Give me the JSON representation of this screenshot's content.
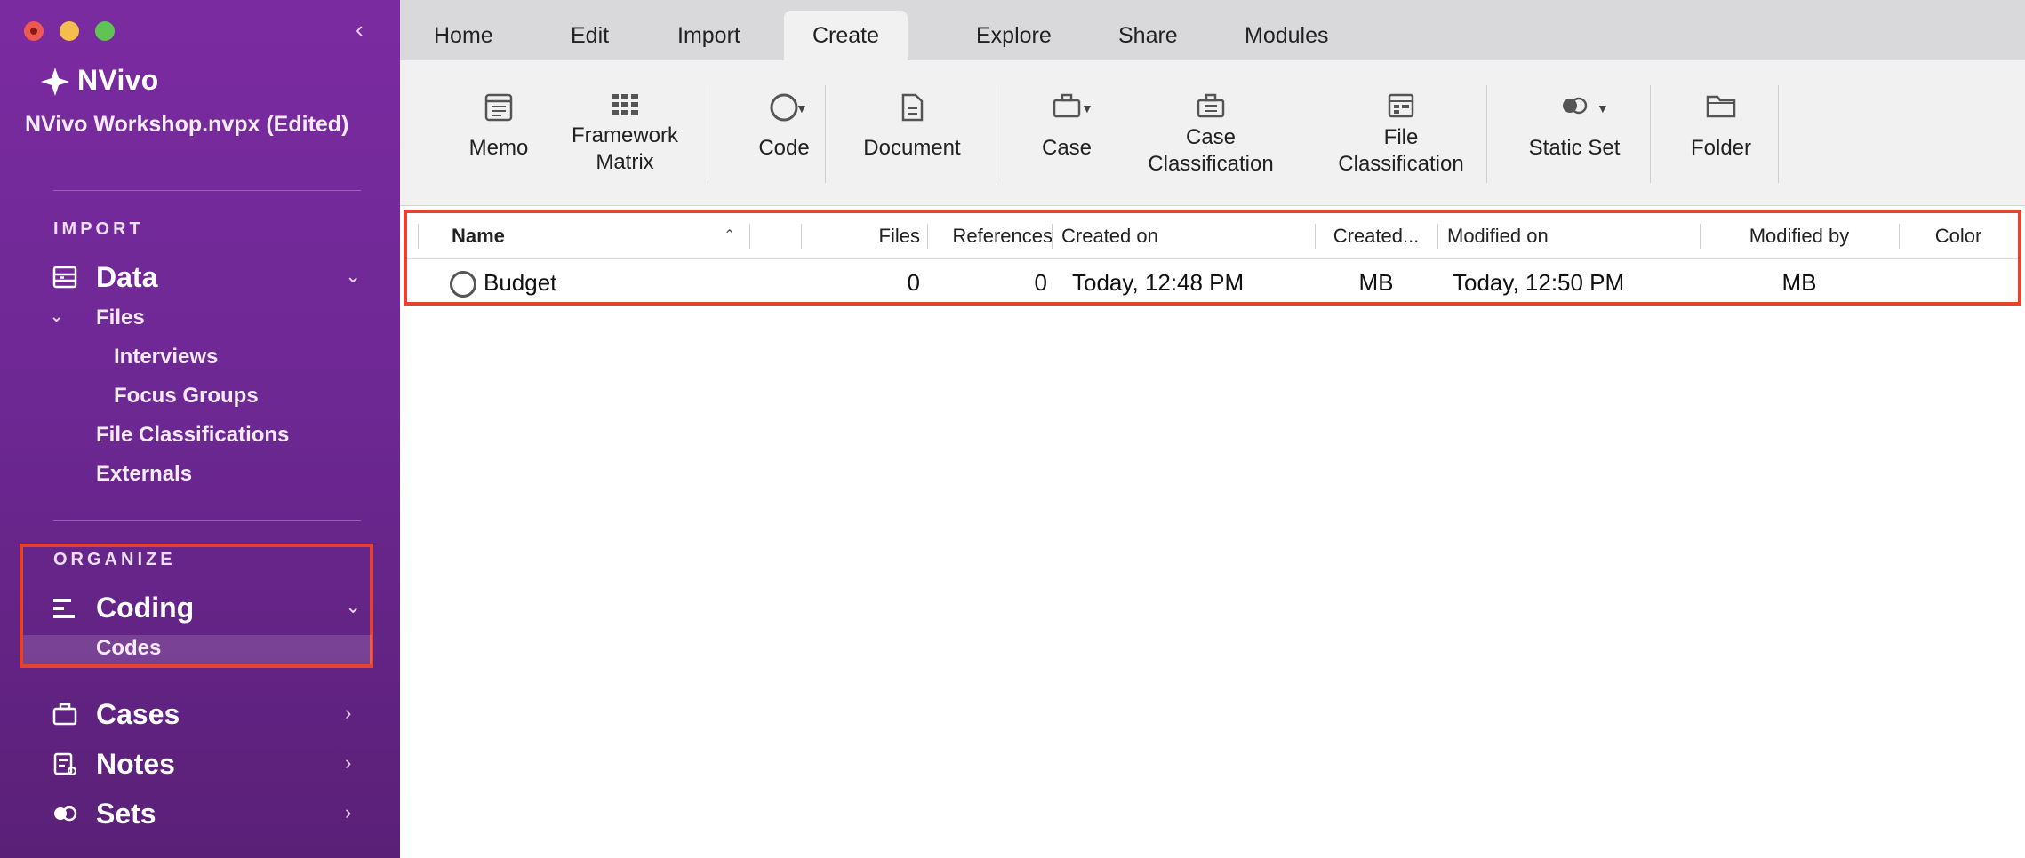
{
  "app": {
    "name": "NVivo",
    "project": "NVivo Workshop.nvpx (Edited)"
  },
  "sidebar": {
    "import_label": "IMPORT",
    "data": {
      "label": "Data",
      "files": "Files",
      "interviews": "Interviews",
      "focus_groups": "Focus Groups",
      "file_classifications": "File Classifications",
      "externals": "Externals"
    },
    "organize_label": "ORGANIZE",
    "coding": {
      "label": "Coding",
      "codes": "Codes"
    },
    "cases": "Cases",
    "notes": "Notes",
    "sets": "Sets"
  },
  "tabs": [
    "Home",
    "Edit",
    "Import",
    "Create",
    "Explore",
    "Share",
    "Modules"
  ],
  "active_tab": "Create",
  "ribbon": {
    "memo": "Memo",
    "framework_line1": "Framework",
    "framework_line2": "Matrix",
    "code": "Code",
    "document": "Document",
    "case": "Case",
    "case_class_line1": "Case",
    "case_class_line2": "Classification",
    "file_class_line1": "File",
    "file_class_line2": "Classification",
    "static_set": "Static Set",
    "folder": "Folder"
  },
  "table": {
    "columns": {
      "name": "Name",
      "files": "Files",
      "references": "References",
      "created_on": "Created on",
      "created_by": "Created...",
      "modified_on": "Modified on",
      "modified_by": "Modified by",
      "color": "Color"
    },
    "rows": [
      {
        "name": "Budget",
        "files": "0",
        "references": "0",
        "created_on": "Today, 12:48 PM",
        "created_by": "MB",
        "modified_on": "Today, 12:50 PM",
        "modified_by": "MB",
        "color": ""
      }
    ]
  },
  "colors": {
    "sidebar_top": "#7a2ba0",
    "sidebar_bottom": "#5a2077",
    "highlight": "#e5432f"
  }
}
